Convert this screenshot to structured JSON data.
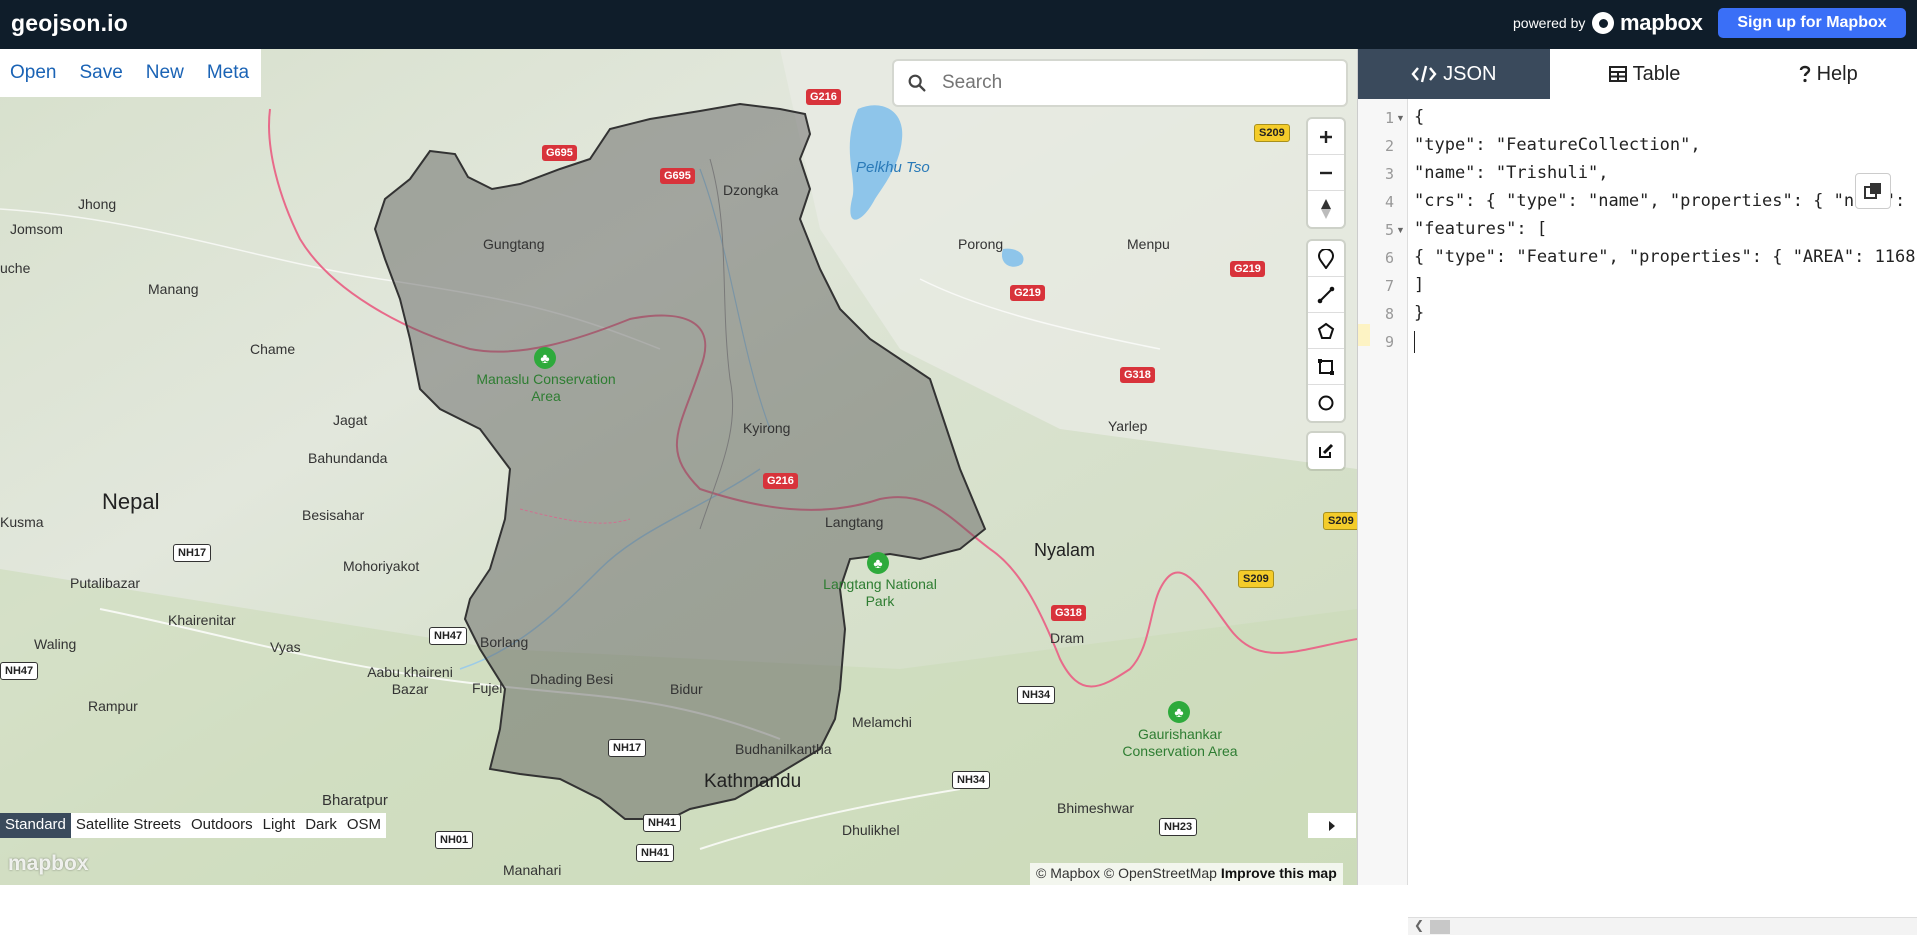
{
  "app": {
    "logo": "geojson.io",
    "powered_by": "powered by",
    "mapbox_brand": "mapbox",
    "signup_label": "Sign up for Mapbox"
  },
  "file_menu": [
    "Open",
    "Save",
    "New",
    "Meta"
  ],
  "search": {
    "placeholder": "Search"
  },
  "map_labels": {
    "countries": {
      "nepal": "Nepal"
    },
    "cities": {
      "kathmandu": "Kathmandu",
      "nyalam": "Nyalam"
    },
    "places": [
      "Jhong",
      "Jomsom",
      "uche",
      "Manang",
      "Chame",
      "Jagat",
      "Bahundanda",
      "Besisahar",
      "Kusma",
      "Mohoriyakot",
      "Putalibazar",
      "Khairenitar",
      "Waling",
      "Vyas",
      "Aabu khaireni Bazar",
      "Rampur",
      "Bharatpur",
      "Manahari",
      "Gungtang",
      "Dzongka",
      "Porong",
      "Menpu",
      "Kyirong",
      "Yarlep",
      "Langtang",
      "Borlang",
      "Fujel",
      "Dhading Besi",
      "Bidur",
      "Budhanilkantha",
      "Melamchi",
      "Dram",
      "Bhimeshwar",
      "Dhulikhel"
    ],
    "parks": {
      "manaslu": "Manaslu Conservation Area",
      "langtang": "Langtang National Park",
      "gaurishankar": "Gaurishankar Conservation Area"
    },
    "lake": "Pelkhu Tso",
    "shields": [
      "G216",
      "G695",
      "G695",
      "G219",
      "G219",
      "G318",
      "G318",
      "G216",
      "S209",
      "S209",
      "S209",
      "NH17",
      "NH47",
      "NH47",
      "NH17",
      "NH34",
      "NH34",
      "NH41",
      "NH41",
      "NH01",
      "NH23"
    ]
  },
  "map_styles": {
    "active": "Standard",
    "options": [
      "Standard",
      "Satellite Streets",
      "Outdoors",
      "Light",
      "Dark",
      "OSM"
    ]
  },
  "attribution": {
    "mapbox": "© Mapbox",
    "osm": "© OpenStreetMap",
    "improve": "Improve this map"
  },
  "panel": {
    "tabs": [
      {
        "label": "JSON",
        "icon": "code-icon",
        "active": true
      },
      {
        "label": "Table",
        "icon": "table-icon",
        "active": false
      },
      {
        "label": "Help",
        "icon": "help-icon",
        "active": false
      }
    ]
  },
  "editor": {
    "line_numbers": [
      "1",
      "2",
      "3",
      "4",
      "5",
      "6",
      "7",
      "8",
      "9"
    ],
    "lines": [
      "{",
      "\"type\": \"FeatureCollection\",",
      "\"name\": \"Trishuli\",",
      "\"crs\": { \"type\": \"name\", \"properties\": { \"name\": ",
      "\"features\": [",
      "{ \"type\": \"Feature\", \"properties\": { \"AREA\": 1168",
      "]",
      "}",
      ""
    ]
  },
  "colors": {
    "topbar": "#0f1d2a",
    "signup": "#3a6ff7",
    "active_tab": "#3a4a5c",
    "link": "#1a63b5",
    "polygon_fill": "#555555",
    "boundary": "#e86a8a"
  }
}
